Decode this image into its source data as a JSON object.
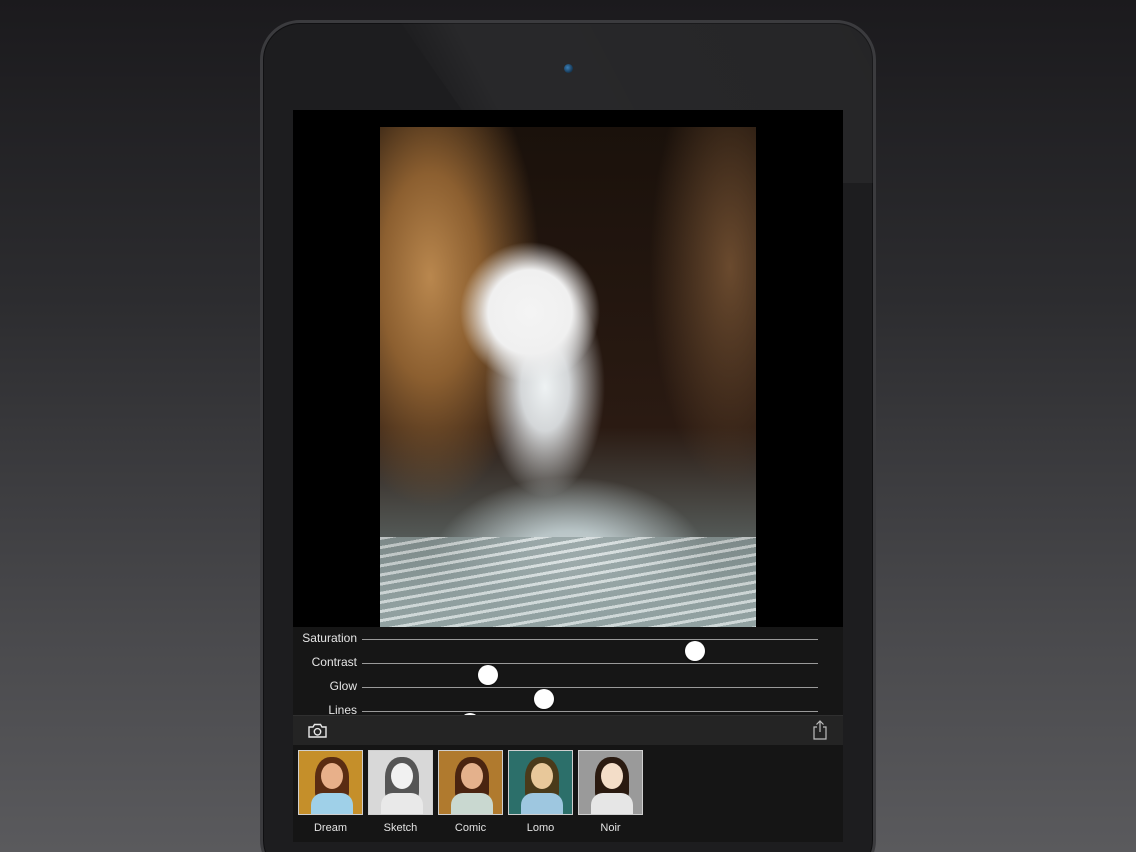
{
  "sliders": [
    {
      "label": "Saturation",
      "value": 0.73
    },
    {
      "label": "Contrast",
      "value": 0.276
    },
    {
      "label": "Glow",
      "value": 0.399
    },
    {
      "label": "Lines",
      "value": 0.237
    }
  ],
  "toolbar": {
    "camera_icon": "camera-icon",
    "share_icon": "share-icon"
  },
  "filters": [
    {
      "label": "Dream",
      "bg": "#c58f2a",
      "hair": "#5a2c12",
      "face": "#e8b08a",
      "body": "#9fd0e8"
    },
    {
      "label": "Sketch",
      "bg": "#d8d8d8",
      "hair": "#555555",
      "face": "#f1f1f1",
      "body": "#e9e9e9"
    },
    {
      "label": "Comic",
      "bg": "#b07a2e",
      "hair": "#4a2410",
      "face": "#e4b18c",
      "body": "#c9d8d0"
    },
    {
      "label": "Lomo",
      "bg": "#2c6f6a",
      "hair": "#4a3a1a",
      "face": "#e8c89a",
      "body": "#9ec7e0"
    },
    {
      "label": "Noir",
      "bg": "#9a9a9a",
      "hair": "#2a1a10",
      "face": "#f3ddc8",
      "body": "#e6e6e6"
    }
  ]
}
